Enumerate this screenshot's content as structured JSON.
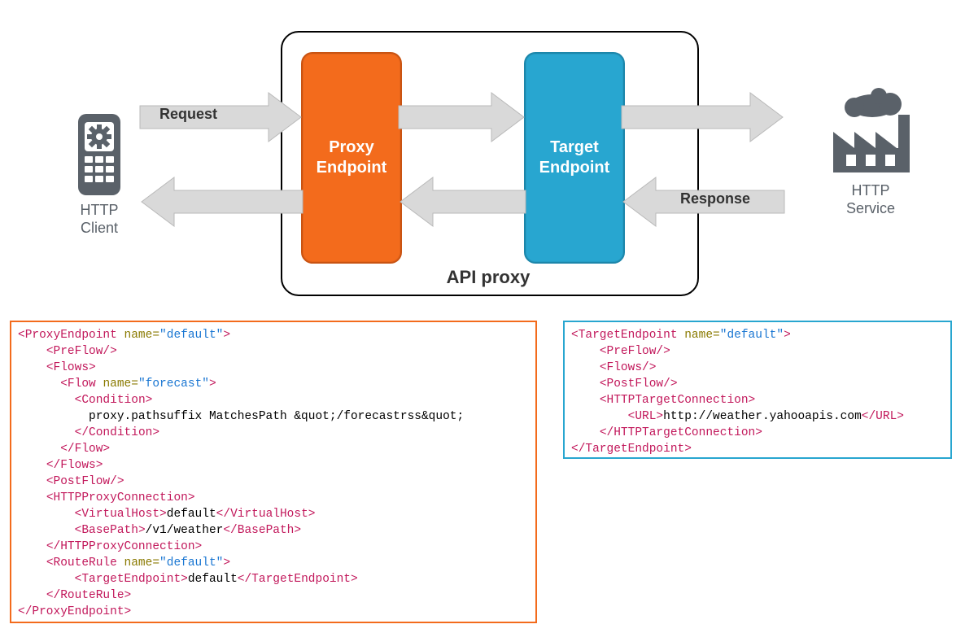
{
  "diagram": {
    "client_label": "HTTP\nClient",
    "service_label": "HTTP\nService",
    "api_proxy_label": "API proxy",
    "proxy_endpoint_label": "Proxy\nEndpoint",
    "target_endpoint_label": "Target\nEndpoint",
    "request_label": "Request",
    "response_label": "Response"
  },
  "colors": {
    "proxy_orange": "#f36b1c",
    "target_blue": "#28a6d0",
    "arrow_fill": "#d9d9d9",
    "arrow_stroke": "#b9b9b9",
    "icon_gray": "#5a6169"
  },
  "code": {
    "proxy_endpoint": [
      [
        {
          "t": "tag",
          "v": "<ProxyEndpoint "
        },
        {
          "t": "attr",
          "v": "name="
        },
        {
          "t": "str",
          "v": "\"default\""
        },
        {
          "t": "tag",
          "v": ">"
        }
      ],
      [
        {
          "t": "text",
          "v": "    "
        },
        {
          "t": "tag",
          "v": "<PreFlow/>"
        }
      ],
      [
        {
          "t": "text",
          "v": "    "
        },
        {
          "t": "tag",
          "v": "<Flows>"
        }
      ],
      [
        {
          "t": "text",
          "v": "      "
        },
        {
          "t": "tag",
          "v": "<Flow "
        },
        {
          "t": "attr",
          "v": "name="
        },
        {
          "t": "str",
          "v": "\"forecast\""
        },
        {
          "t": "tag",
          "v": ">"
        }
      ],
      [
        {
          "t": "text",
          "v": "        "
        },
        {
          "t": "tag",
          "v": "<Condition>"
        }
      ],
      [
        {
          "t": "text",
          "v": "          proxy.pathsuffix MatchesPath &quot;/forecastrss&quot;"
        }
      ],
      [
        {
          "t": "text",
          "v": "        "
        },
        {
          "t": "tag",
          "v": "</Condition>"
        }
      ],
      [
        {
          "t": "text",
          "v": "      "
        },
        {
          "t": "tag",
          "v": "</Flow>"
        }
      ],
      [
        {
          "t": "text",
          "v": "    "
        },
        {
          "t": "tag",
          "v": "</Flows>"
        }
      ],
      [
        {
          "t": "text",
          "v": "    "
        },
        {
          "t": "tag",
          "v": "<PostFlow/>"
        }
      ],
      [
        {
          "t": "text",
          "v": "    "
        },
        {
          "t": "tag",
          "v": "<HTTPProxyConnection>"
        }
      ],
      [
        {
          "t": "text",
          "v": "        "
        },
        {
          "t": "tag",
          "v": "<VirtualHost>"
        },
        {
          "t": "text",
          "v": "default"
        },
        {
          "t": "tag",
          "v": "</VirtualHost>"
        }
      ],
      [
        {
          "t": "text",
          "v": "        "
        },
        {
          "t": "tag",
          "v": "<BasePath>"
        },
        {
          "t": "text",
          "v": "/v1/weather"
        },
        {
          "t": "tag",
          "v": "</BasePath>"
        }
      ],
      [
        {
          "t": "text",
          "v": "    "
        },
        {
          "t": "tag",
          "v": "</HTTPProxyConnection>"
        }
      ],
      [
        {
          "t": "text",
          "v": "    "
        },
        {
          "t": "tag",
          "v": "<RouteRule "
        },
        {
          "t": "attr",
          "v": "name="
        },
        {
          "t": "str",
          "v": "\"default\""
        },
        {
          "t": "tag",
          "v": ">"
        }
      ],
      [
        {
          "t": "text",
          "v": "        "
        },
        {
          "t": "tag",
          "v": "<TargetEndpoint>"
        },
        {
          "t": "text",
          "v": "default"
        },
        {
          "t": "tag",
          "v": "</TargetEndpoint>"
        }
      ],
      [
        {
          "t": "text",
          "v": "    "
        },
        {
          "t": "tag",
          "v": "</RouteRule>"
        }
      ],
      [
        {
          "t": "tag",
          "v": "</ProxyEndpoint>"
        }
      ]
    ],
    "target_endpoint": [
      [
        {
          "t": "tag",
          "v": "<TargetEndpoint "
        },
        {
          "t": "attr",
          "v": "name="
        },
        {
          "t": "str",
          "v": "\"default\""
        },
        {
          "t": "tag",
          "v": ">"
        }
      ],
      [
        {
          "t": "text",
          "v": "    "
        },
        {
          "t": "tag",
          "v": "<PreFlow/>"
        }
      ],
      [
        {
          "t": "text",
          "v": "    "
        },
        {
          "t": "tag",
          "v": "<Flows/>"
        }
      ],
      [
        {
          "t": "text",
          "v": "    "
        },
        {
          "t": "tag",
          "v": "<PostFlow/>"
        }
      ],
      [
        {
          "t": "text",
          "v": "    "
        },
        {
          "t": "tag",
          "v": "<HTTPTargetConnection>"
        }
      ],
      [
        {
          "t": "text",
          "v": "        "
        },
        {
          "t": "tag",
          "v": "<URL>"
        },
        {
          "t": "text",
          "v": "http://weather.yahooapis.com"
        },
        {
          "t": "tag",
          "v": "</URL>"
        }
      ],
      [
        {
          "t": "text",
          "v": "    "
        },
        {
          "t": "tag",
          "v": "</HTTPTargetConnection>"
        }
      ],
      [
        {
          "t": "tag",
          "v": "</TargetEndpoint>"
        }
      ]
    ]
  }
}
